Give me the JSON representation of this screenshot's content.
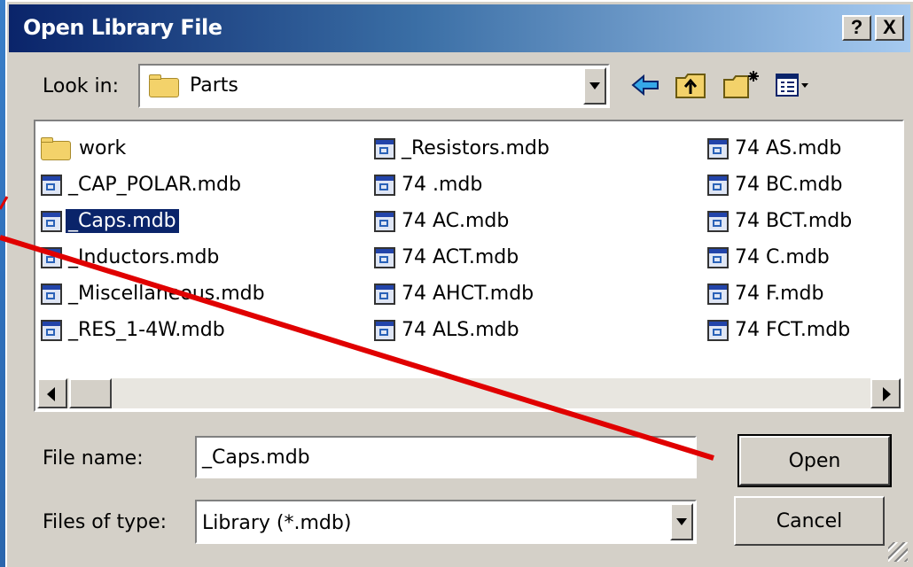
{
  "window": {
    "title": "Open Library File",
    "help_button": "?",
    "close_button": "X"
  },
  "lookin": {
    "label": "Look in:",
    "value": "Parts"
  },
  "toolbar": {
    "icons": [
      "back-arrow-icon",
      "up-folder-icon",
      "new-folder-icon",
      "view-menu-icon"
    ]
  },
  "files": {
    "columns": [
      [
        {
          "name": "work",
          "type": "folder"
        },
        {
          "name": "_CAP_POLAR.mdb",
          "type": "mdb"
        },
        {
          "name": "_Caps.mdb",
          "type": "mdb",
          "selected": true
        },
        {
          "name": "_Inductors.mdb",
          "type": "mdb"
        },
        {
          "name": "_Miscellaneous.mdb",
          "type": "mdb"
        },
        {
          "name": "_RES_1-4W.mdb",
          "type": "mdb"
        }
      ],
      [
        {
          "name": "_Resistors.mdb",
          "type": "mdb"
        },
        {
          "name": "74 .mdb",
          "type": "mdb"
        },
        {
          "name": "74 AC.mdb",
          "type": "mdb"
        },
        {
          "name": "74 ACT.mdb",
          "type": "mdb"
        },
        {
          "name": "74 AHCT.mdb",
          "type": "mdb"
        },
        {
          "name": "74 ALS.mdb",
          "type": "mdb"
        }
      ],
      [
        {
          "name": "74 AS.mdb",
          "type": "mdb"
        },
        {
          "name": "74 BC.mdb",
          "type": "mdb"
        },
        {
          "name": "74 BCT.mdb",
          "type": "mdb"
        },
        {
          "name": "74 C.mdb",
          "type": "mdb"
        },
        {
          "name": "74 F.mdb",
          "type": "mdb"
        },
        {
          "name": "74 FCT.mdb",
          "type": "mdb"
        }
      ]
    ]
  },
  "filename": {
    "label": "File name:",
    "value": "_Caps.mdb"
  },
  "filetype": {
    "label": "Files of type:",
    "value": "Library (*.mdb)"
  },
  "buttons": {
    "open": "Open",
    "cancel": "Cancel"
  },
  "colors": {
    "annotation_line": "#e00000",
    "selection": "#0a246a",
    "titlebar": "#0a246a"
  }
}
